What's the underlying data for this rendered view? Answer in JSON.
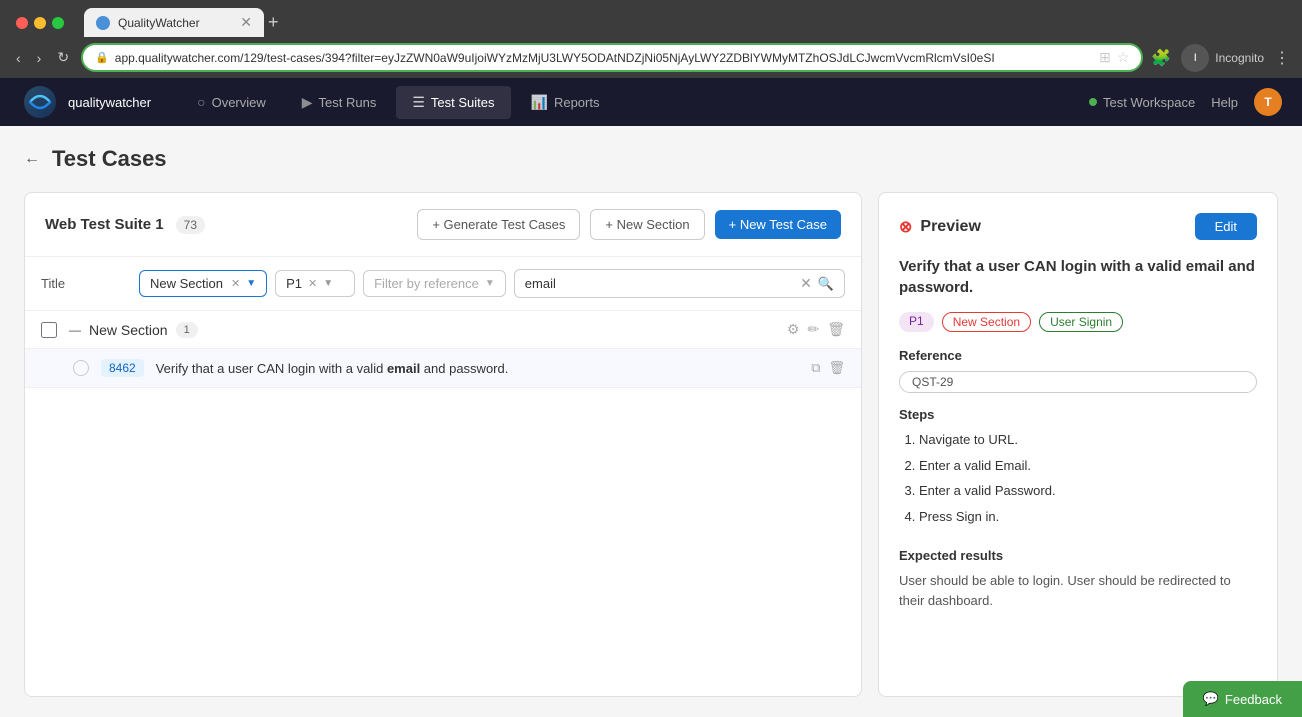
{
  "browser": {
    "tab_title": "QualityWatcher",
    "url": "app.qualitywatcher.com/129/test-cases/394?filter=eyJzZWN0aW9uIjoiWYzMzMjU3LWY5ODAtNDZjNi05NjAyLWY2ZDBlYWMyMTZhOSJdLCJwcmVvcmRlcmVsI0eSI",
    "new_tab_btn": "+",
    "nav_back": "‹",
    "nav_forward": "›",
    "nav_refresh": "↻",
    "extensions_icon": "⬛",
    "star_icon": "☆",
    "puzzle_icon": "🧩",
    "profile_label": "Incognito",
    "more_icon": "⋮",
    "profile_initial": "I"
  },
  "app_nav": {
    "logo_text": "qualitywatcher",
    "items": [
      {
        "label": "Overview",
        "icon": "○",
        "active": false
      },
      {
        "label": "Test Runs",
        "icon": "▶",
        "active": false
      },
      {
        "label": "Test Suites",
        "icon": "☰",
        "active": true
      },
      {
        "label": "Reports",
        "icon": "📊",
        "active": false
      }
    ],
    "workspace_label": "Test Workspace",
    "help_label": "Help",
    "user_initial": "T"
  },
  "page": {
    "back_icon": "←",
    "title": "Test Cases"
  },
  "suite": {
    "name": "Web Test Suite 1",
    "count": "73",
    "generate_btn": "+ Generate Test Cases",
    "new_section_btn": "+ New Section",
    "new_test_case_btn": "+ New Test Case",
    "filter": {
      "title_col": "Title",
      "section_filter_text": "New Section",
      "priority_filter_text": "P1",
      "ref_placeholder": "Filter by reference",
      "search_value": "email"
    },
    "sections": [
      {
        "name": "New Section",
        "count": "1",
        "test_cases": [
          {
            "id": "8462",
            "title_prefix": "Verify that a user CAN login with a valid ",
            "title_bold": "email",
            "title_suffix": " and password."
          }
        ]
      }
    ]
  },
  "preview": {
    "title": "Preview",
    "edit_btn": "Edit",
    "test_title": "Verify that a user CAN login with a valid email and password.",
    "tags": [
      "P1",
      "New Section",
      "User Signin"
    ],
    "reference_label": "Reference",
    "reference_value": "QST-29",
    "steps_label": "Steps",
    "steps": [
      "Navigate to URL.",
      "Enter a valid Email.",
      "Enter a valid Password.",
      "Press Sign in."
    ],
    "expected_label": "Expected results",
    "expected_text": "User should be able to login. User should be redirected to their dashboard."
  },
  "feedback": {
    "label": "Feedback"
  }
}
